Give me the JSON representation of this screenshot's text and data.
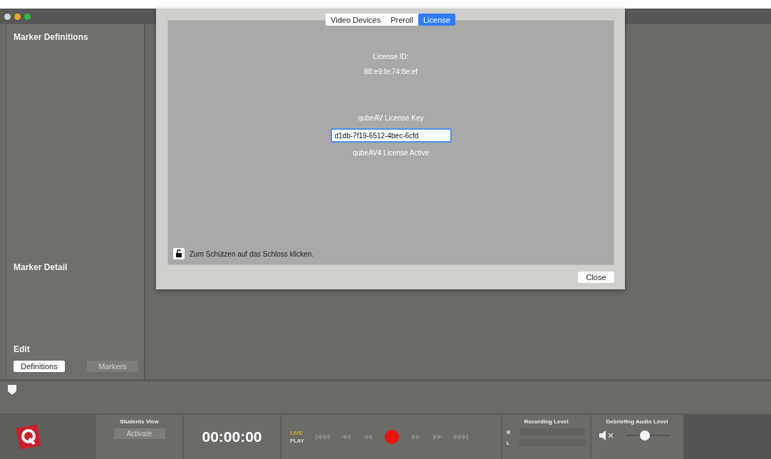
{
  "sidebar": {
    "definitions_title": "Marker Definitions",
    "detail_title": "Marker Detail",
    "edit_title": "Edit",
    "edit_buttons": [
      {
        "label": "Definitions",
        "disabled": false
      },
      {
        "label": "Markers",
        "disabled": true
      }
    ]
  },
  "dialog": {
    "tabs": [
      {
        "label": "Video Devices",
        "selected": false
      },
      {
        "label": "Preroll",
        "selected": false
      },
      {
        "label": "License",
        "selected": true
      }
    ],
    "license_id_label": "License ID:",
    "license_id": "88:e9:fe:74:8e:ef",
    "key_label": "qubeAV License Key",
    "key_value": "d1db-7f19-6512-4bec-6cfd",
    "status": "qubeAV4 License Active",
    "lock_text": "Zum Schützen auf das Schloss klicken.",
    "close_button": "Close"
  },
  "timeline": {
    "level": 0
  },
  "bottom_bar": {
    "students_view": {
      "title": "Students View",
      "button": "Activate",
      "disabled": true
    },
    "timecode": "00:00:00",
    "live": "LIVE",
    "play": "PLAY",
    "recording_level": {
      "title": "Recording Level",
      "channels": [
        {
          "name": "R",
          "level": 0
        },
        {
          "name": "L",
          "level": 0
        }
      ]
    },
    "debriefing": {
      "title": "Debriefing Audio Level",
      "muted": true,
      "level": 0.42
    }
  }
}
